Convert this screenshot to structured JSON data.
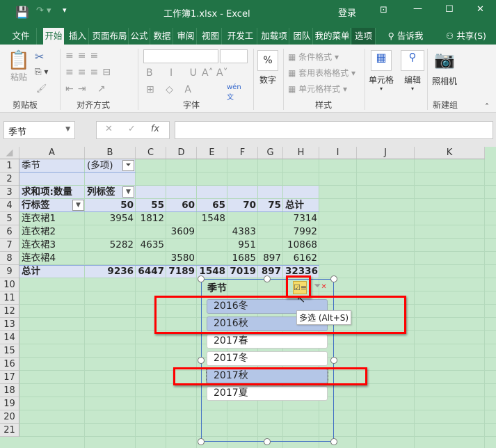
{
  "title": "工作簿1.xlsx  -  Excel",
  "login": "登录",
  "tabs": [
    "文件",
    "开始",
    "插入",
    "页面布局",
    "公式",
    "数据",
    "审阅",
    "视图",
    "开发工具",
    "加载项",
    "团队",
    "我的菜单",
    "选项"
  ],
  "tell_me": "告诉我",
  "share": "共享(S)",
  "ribbon": {
    "paste": "粘贴",
    "clipboard": "剪贴板",
    "alignment": "对齐方式",
    "font": "字体",
    "number": "数字",
    "cond_format": "条件格式",
    "table_format": "套用表格格式",
    "cell_style": "单元格样式",
    "styles": "样式",
    "cells": "单元格",
    "editing": "编辑",
    "camera": "照相机",
    "new_group": "新建组",
    "percent": "%"
  },
  "name_box": "季节",
  "formula": "",
  "columns": [
    "A",
    "B",
    "C",
    "D",
    "E",
    "F",
    "G",
    "H",
    "I",
    "J",
    "K"
  ],
  "rows": [
    "1",
    "2",
    "3",
    "4",
    "5",
    "6",
    "7",
    "8",
    "9",
    "10",
    "11",
    "12",
    "13",
    "14",
    "15",
    "16",
    "17",
    "18",
    "19",
    "20",
    "21"
  ],
  "pivot": {
    "filter_label": "季节",
    "filter_value": "(多项)",
    "sum_label": "求和项:数量",
    "col_label": "列标签",
    "row_label": "行标签",
    "headers": [
      "50",
      "55",
      "60",
      "65",
      "70",
      "75",
      "总计"
    ],
    "data": [
      [
        "连衣裙1",
        "3954",
        "1812",
        "",
        "1548",
        "",
        "",
        "7314"
      ],
      [
        "连衣裙2",
        "",
        "",
        "3609",
        "",
        "4383",
        "",
        "7992"
      ],
      [
        "连衣裙3",
        "5282",
        "4635",
        "",
        "",
        "951",
        "",
        "10868"
      ],
      [
        "连衣裙4",
        "",
        "",
        "3580",
        "",
        "1685",
        "897",
        "6162"
      ],
      [
        "总计",
        "9236",
        "6447",
        "7189",
        "1548",
        "7019",
        "897",
        "32336"
      ]
    ]
  },
  "slicer": {
    "title": "季节",
    "items": [
      {
        "label": "2016冬",
        "selected": true
      },
      {
        "label": "2016秋",
        "selected": true
      },
      {
        "label": "2017春",
        "selected": false
      },
      {
        "label": "2017冬",
        "selected": false
      },
      {
        "label": "2017秋",
        "selected": true
      },
      {
        "label": "2017夏",
        "selected": false
      }
    ],
    "tooltip": "多选 (Alt+S)"
  }
}
